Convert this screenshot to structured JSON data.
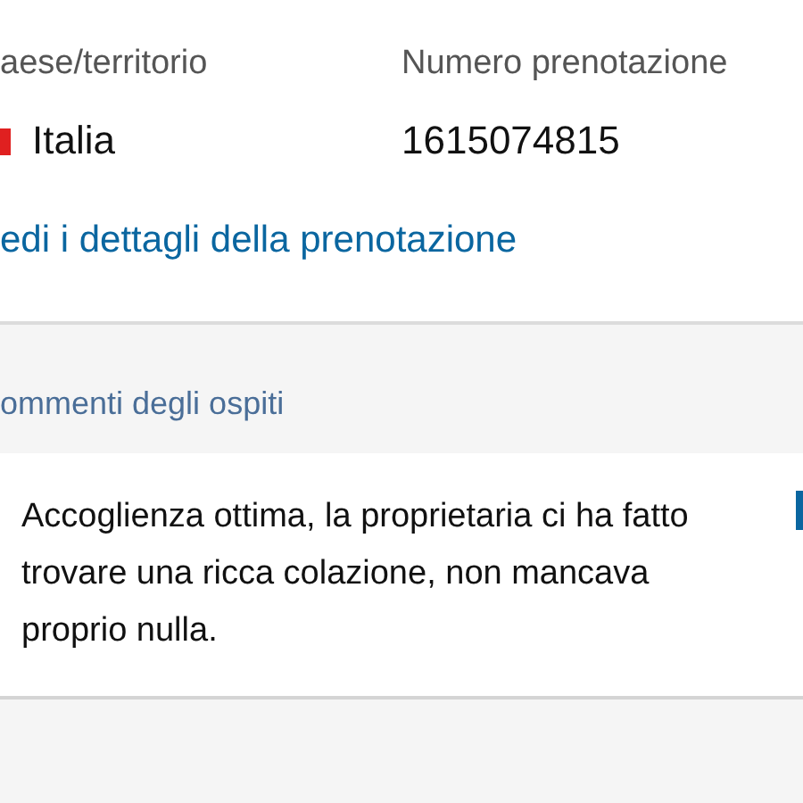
{
  "booking_info": {
    "fields": [
      {
        "label": "aese/territorio",
        "value": "Italia",
        "kind": "country"
      },
      {
        "label": "Numero prenotazione",
        "value": "1615074815",
        "kind": "text"
      }
    ],
    "details_link": "edi i dettagli della prenotazione"
  },
  "guest_comments": {
    "heading": "ommenti degli ospiti",
    "comment": "Accoglienza ottima, la proprietaria ci ha fatto trovare una ricca colazione, non mancava proprio nulla."
  }
}
